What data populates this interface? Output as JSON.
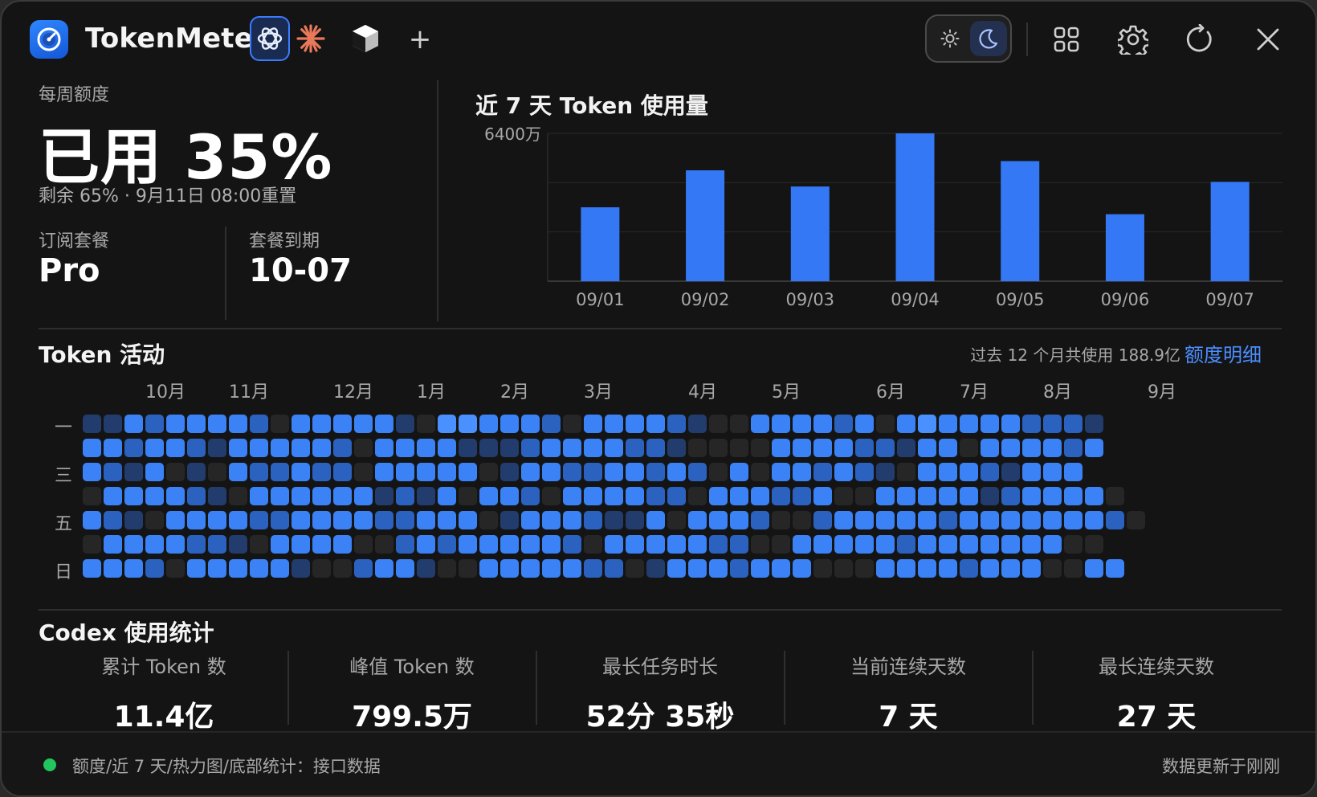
{
  "app": {
    "name": "TokenMeter",
    "providers": [
      {
        "name": "openai-icon",
        "active": true
      },
      {
        "name": "claude-icon",
        "active": false
      },
      {
        "name": "cube-icon",
        "active": false
      }
    ],
    "add_label": "+",
    "theme": "dark"
  },
  "quota": {
    "label": "每周额度",
    "used_text": "已用 35%",
    "used_percent": 35,
    "sub_text": "剩余 65% · 9月11日 08:00重置",
    "plan_label": "订阅套餐",
    "plan_value": "Pro",
    "expire_label": "套餐到期",
    "expire_value": "10-07"
  },
  "chart_data": {
    "type": "bar",
    "title": "近 7 天 Token 使用量",
    "categories": [
      "09/01",
      "09/02",
      "09/03",
      "09/04",
      "09/05",
      "09/06",
      "09/07"
    ],
    "values": [
      3200,
      4800,
      4100,
      6400,
      5200,
      2900,
      4300
    ],
    "y_max_label": "6400万",
    "ylim": [
      0,
      6400
    ],
    "unit": "万",
    "color": "#3478f6",
    "grid": true
  },
  "activity": {
    "title": "Token 活动",
    "summary": "过去 12 个月共使用 188.9亿",
    "link": "额度明细",
    "months": [
      {
        "label": "10月",
        "col": 3
      },
      {
        "label": "11月",
        "col": 7
      },
      {
        "label": "12月",
        "col": 12
      },
      {
        "label": "1月",
        "col": 16
      },
      {
        "label": "2月",
        "col": 20
      },
      {
        "label": "3月",
        "col": 24
      },
      {
        "label": "4月",
        "col": 29
      },
      {
        "label": "5月",
        "col": 33
      },
      {
        "label": "6月",
        "col": 38
      },
      {
        "label": "7月",
        "col": 42
      },
      {
        "label": "8月",
        "col": 46
      },
      {
        "label": "9月",
        "col": 51
      }
    ],
    "day_labels": [
      {
        "label": "一",
        "row": 0
      },
      {
        "label": "三",
        "row": 2
      },
      {
        "label": "五",
        "row": 4
      },
      {
        "label": "日",
        "row": 6
      }
    ],
    "palette": [
      "#262626",
      "#223c6d",
      "#2b61bf",
      "#3b82f6",
      "#4b90ff"
    ],
    "grid": [
      "1132333320333331044333203333210033332303433332221",
      "3323321333332033331112333322100003333221330333323",
      "321301032232203333301332233232030332321033321333",
      "03333210333333121303320333322033322300333331233330",
      "321033332233332233301333211303332002333332333333320",
      "0333322103333002323333320333332200333332333333300",
      "33320333331002331003333322013332333000333323330033"
    ]
  },
  "codex": {
    "title": "Codex 使用统计",
    "stats": [
      {
        "label": "累计 Token 数",
        "value": "11.4亿"
      },
      {
        "label": "峰值 Token 数",
        "value": "799.5万"
      },
      {
        "label": "最长任务时长",
        "value": "52分 35秒"
      },
      {
        "label": "当前连续天数",
        "value": "7 天"
      },
      {
        "label": "最长连续天数",
        "value": "27 天"
      }
    ]
  },
  "footer": {
    "left": "额度/近 7 天/热力图/底部统计：接口数据",
    "right": "数据更新于刚刚",
    "status_color": "#22c55e"
  }
}
